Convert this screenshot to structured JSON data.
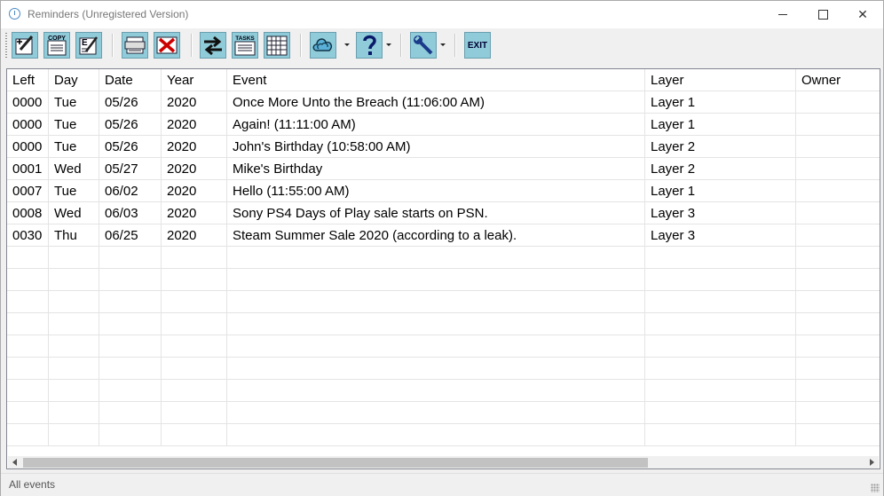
{
  "window": {
    "title": "Reminders (Unregistered Version)"
  },
  "toolbar": {
    "buttons": [
      {
        "name": "new-reminder",
        "icon": "new-pencil-icon"
      },
      {
        "name": "copy",
        "icon": "copy-icon",
        "label": "COPY"
      },
      {
        "name": "edit",
        "icon": "edit-icon",
        "label": "E"
      },
      {
        "name": "print",
        "icon": "print-icon"
      },
      {
        "name": "delete",
        "icon": "delete-x-icon"
      },
      {
        "name": "transfer",
        "icon": "swap-arrows-icon"
      },
      {
        "name": "tasks",
        "icon": "tasks-icon",
        "label": "TASKS"
      },
      {
        "name": "calendar",
        "icon": "calendar-grid-icon"
      },
      {
        "name": "sync",
        "icon": "cloud-icon"
      },
      {
        "name": "help",
        "icon": "question-icon"
      },
      {
        "name": "tools",
        "icon": "wrench-icon"
      },
      {
        "name": "exit",
        "icon": "exit-icon",
        "label": "EXIT"
      }
    ]
  },
  "grid": {
    "columns": [
      "Left",
      "Day",
      "Date",
      "Year",
      "Event",
      "Layer",
      "Owner"
    ],
    "rows": [
      [
        "0000",
        "Tue",
        "05/26",
        "2020",
        "Once More Unto the Breach (11:06:00 AM)",
        "Layer 1",
        ""
      ],
      [
        "0000",
        "Tue",
        "05/26",
        "2020",
        "Again! (11:11:00 AM)",
        "Layer 1",
        ""
      ],
      [
        "0000",
        "Tue",
        "05/26",
        "2020",
        "John's Birthday (10:58:00 AM)",
        "Layer 2",
        ""
      ],
      [
        "0001",
        "Wed",
        "05/27",
        "2020",
        "Mike's Birthday",
        "Layer 2",
        ""
      ],
      [
        "0007",
        "Tue",
        "06/02",
        "2020",
        "Hello (11:55:00 AM)",
        "Layer 1",
        ""
      ],
      [
        "0008",
        "Wed",
        "06/03",
        "2020",
        "Sony PS4 Days of Play sale starts on PSN.",
        "Layer 3",
        ""
      ],
      [
        "0030",
        "Thu",
        "06/25",
        "2020",
        "Steam Summer Sale 2020 (according to a leak).",
        "Layer 3",
        ""
      ]
    ],
    "empty_rows": 9
  },
  "status": {
    "text": "All events"
  },
  "colors": {
    "toolbar_button": "#8fcbd8",
    "grid_lines": "#e4e4e4"
  }
}
